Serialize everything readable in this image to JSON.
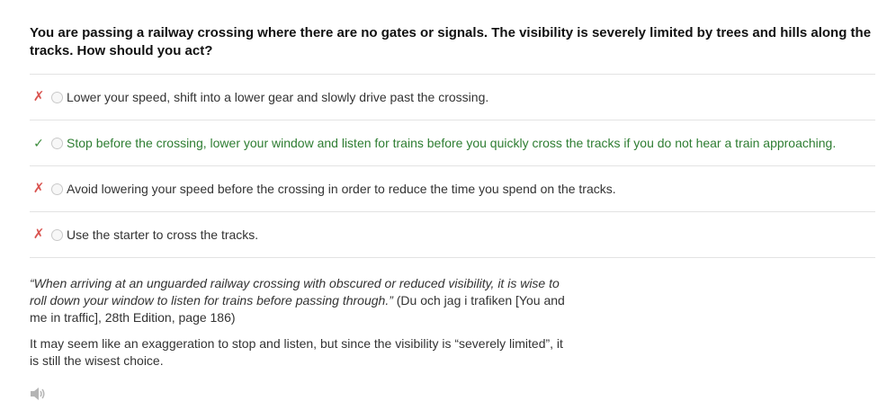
{
  "question": {
    "text": "You are passing a railway crossing where there are no gates or signals. The visibility is severely limited by trees and hills along the tracks. How should you act?"
  },
  "options": [
    {
      "text": "Lower your speed, shift into a lower gear and slowly drive past the crossing.",
      "mark": "✗",
      "status": "wrong"
    },
    {
      "text": "Stop before the crossing, lower your window and listen for trains before you quickly cross the tracks if you do not hear a train approaching.",
      "mark": "✓",
      "status": "correct"
    },
    {
      "text": "Avoid lowering your speed before the crossing in order to reduce the time you spend on the tracks.",
      "mark": "✗",
      "status": "wrong"
    },
    {
      "text": "Use the starter to cross the tracks.",
      "mark": "✗",
      "status": "wrong"
    }
  ],
  "explanation": {
    "quote": "“When arriving at an unguarded railway crossing with obscured or reduced visibility, it is wise to roll down your window to listen for trains before passing through.”",
    "source": " (Du och jag i trafiken [You and me in traffic], 28th Edition, page 186)",
    "note": "It may seem like an exaggeration to stop and listen, but since the visibility is “severely limited”, it is still the wisest choice."
  },
  "colors": {
    "correct": "#2e7d32",
    "wrong_mark": "#d9534f",
    "divider": "#e3e3e3"
  },
  "icons": {
    "audio": "speaker-icon"
  }
}
